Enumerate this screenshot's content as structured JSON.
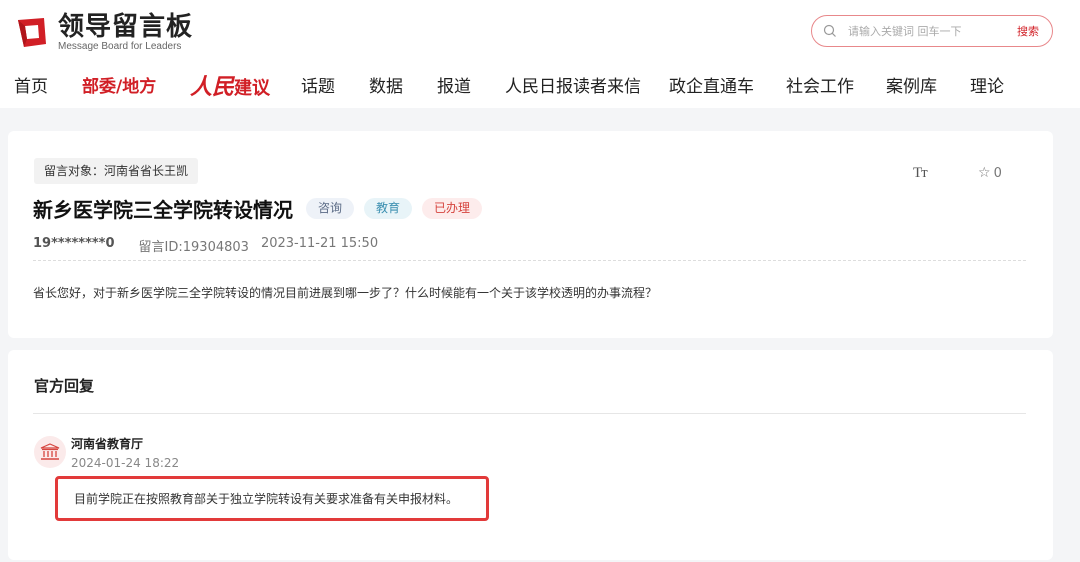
{
  "header": {
    "logo_title": "领导留言板",
    "logo_subtitle": "Message Board for Leaders",
    "brand_color": "#d11f26"
  },
  "search": {
    "placeholder": "请输入关键词 回车一下",
    "button_label": "搜索"
  },
  "nav": {
    "items": [
      {
        "label": "首页"
      },
      {
        "label": "部委/地方",
        "active": true
      },
      {
        "label_script": "人民",
        "label": "建议"
      },
      {
        "label": "话题"
      },
      {
        "label": "数据"
      },
      {
        "label": "报道"
      },
      {
        "label": "人民日报读者来信"
      },
      {
        "label": "政企直通车"
      },
      {
        "label": "社会工作"
      },
      {
        "label": "案例库"
      },
      {
        "label": "理论"
      }
    ]
  },
  "message": {
    "target_label": "留言对象：河南省省长王凯",
    "font_size_icon": "Tт",
    "favorite_icon": "star-outline-icon",
    "favorite_count": "0",
    "title": "新乡医学院三全学院转设情况",
    "tags": [
      "咨询",
      "教育",
      "已办理"
    ],
    "user": "19********0",
    "message_id": "留言ID:19304803",
    "datetime": "2023-11-21 15:50",
    "content": "省长您好，对于新乡医学院三全学院转设的情况目前进展到哪一步了？什么时候能有一个关于该学校透明的办事流程？"
  },
  "reply": {
    "heading": "官方回复",
    "org_icon": "government-building-icon",
    "org_name": "河南省教育厅",
    "datetime": "2024-01-24 18:22",
    "text": "目前学院正在按照教育部关于独立学院转设有关要求准备有关申报材料。",
    "highlight_color": "#e23a3a"
  }
}
